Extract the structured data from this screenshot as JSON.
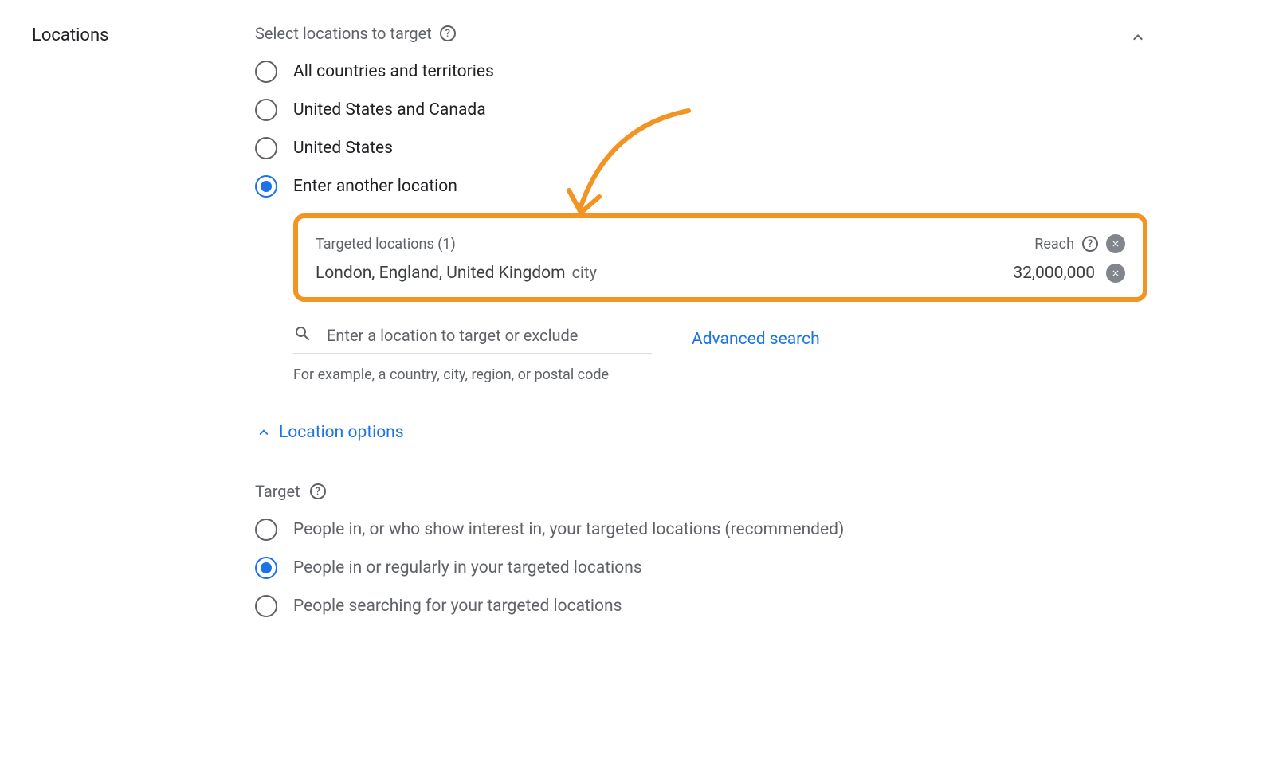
{
  "section_label": "Locations",
  "subheader": "Select locations to target",
  "location_radios": [
    {
      "label": "All countries and territories",
      "selected": false
    },
    {
      "label": "United States and Canada",
      "selected": false
    },
    {
      "label": "United States",
      "selected": false
    },
    {
      "label": "Enter another location",
      "selected": true
    }
  ],
  "targeted_box": {
    "header_label": "Targeted locations (1)",
    "reach_label": "Reach",
    "location_name": "London, England, United Kingdom",
    "location_type": "city",
    "reach_value": "32,000,000"
  },
  "search": {
    "placeholder": "Enter a location to target or exclude",
    "advanced_label": "Advanced search",
    "hint": "For example, a country, city, region, or postal code"
  },
  "location_options_label": "Location options",
  "target": {
    "header": "Target",
    "options": [
      {
        "label": "People in, or who show interest in, your targeted locations (recommended)",
        "selected": false
      },
      {
        "label": "People in or regularly in your targeted locations",
        "selected": true
      },
      {
        "label": "People searching for your targeted locations",
        "selected": false
      }
    ]
  }
}
